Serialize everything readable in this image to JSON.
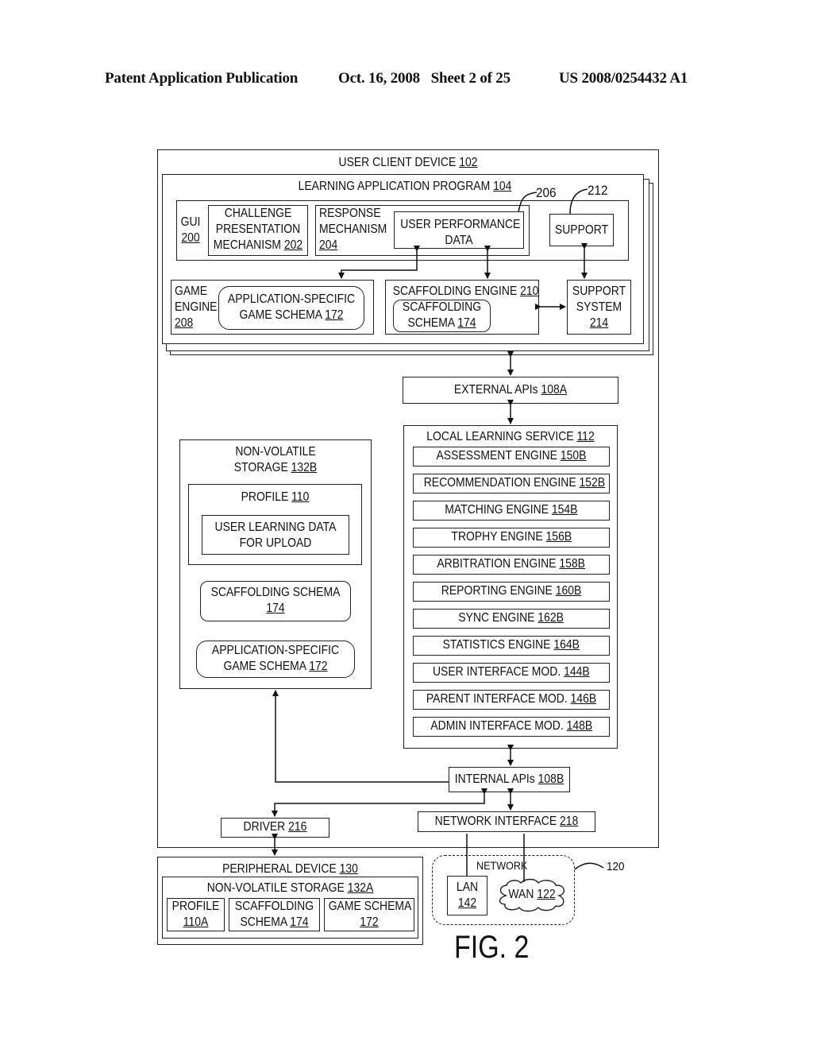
{
  "header": {
    "publication": "Patent Application Publication",
    "date_sheet": "Oct. 16, 2008   Sheet 2 of 25",
    "patent_number": "US 2008/0254432 A1"
  },
  "figure_label": "FIG. 2",
  "user_client_device": {
    "label": "USER CLIENT DEVICE",
    "ref": "102"
  },
  "learning_app": {
    "label": "LEARNING APPLICATION PROGRAM",
    "ref": "104"
  },
  "callouts": {
    "user_perf": "206",
    "support": "212",
    "network": "120"
  },
  "gui": {
    "label": "GUI",
    "ref": "200"
  },
  "challenge": {
    "line1": "CHALLENGE",
    "line2": "PRESENTATION",
    "line3": "MECHANISM",
    "ref": "202"
  },
  "response": {
    "line1": "RESPONSE",
    "line2": "MECHANISM",
    "ref": "204"
  },
  "user_performance": {
    "line1": "USER PERFORMANCE",
    "line2": "DATA"
  },
  "support": {
    "label": "SUPPORT"
  },
  "game_engine": {
    "line1": "GAME",
    "line2": "ENGINE",
    "ref": "208"
  },
  "app_game_schema": {
    "line1": "APPLICATION-SPECIFIC",
    "line2": "GAME SCHEMA",
    "ref": "172"
  },
  "scaffolding_engine": {
    "label": "SCAFFOLDING ENGINE",
    "ref": "210"
  },
  "scaffolding_schema_inner": {
    "line1": "SCAFFOLDING",
    "line2": "SCHEMA",
    "ref": "174"
  },
  "support_system": {
    "line1": "SUPPORT",
    "line2": "SYSTEM",
    "ref": "214"
  },
  "external_apis": {
    "label": "EXTERNAL APIs",
    "ref": "108A"
  },
  "local_learning_service": {
    "label": "LOCAL LEARNING SERVICE",
    "ref": "112",
    "modules": [
      {
        "label": "ASSESSMENT ENGINE",
        "ref": "150B"
      },
      {
        "label": "RECOMMENDATION ENGINE",
        "ref": "152B"
      },
      {
        "label": "MATCHING ENGINE",
        "ref": "154B"
      },
      {
        "label": "TROPHY ENGINE",
        "ref": "156B"
      },
      {
        "label": "ARBITRATION ENGINE",
        "ref": "158B"
      },
      {
        "label": "REPORTING ENGINE",
        "ref": "160B"
      },
      {
        "label": "SYNC ENGINE",
        "ref": "162B"
      },
      {
        "label": "STATISTICS ENGINE",
        "ref": "164B"
      },
      {
        "label": "USER INTERFACE MOD.",
        "ref": "144B"
      },
      {
        "label": "PARENT INTERFACE MOD.",
        "ref": "146B"
      },
      {
        "label": "ADMIN INTERFACE MOD.",
        "ref": "148B"
      }
    ]
  },
  "nv_storage_b": {
    "line1": "NON-VOLATILE",
    "line2": "STORAGE",
    "ref": "132B"
  },
  "profile_110": {
    "label": "PROFILE",
    "ref": "110"
  },
  "user_learning_data": {
    "line1": "USER LEARNING DATA",
    "line2": "FOR UPLOAD"
  },
  "scaffolding_schema_b": {
    "line1": "SCAFFOLDING SCHEMA",
    "ref": "174"
  },
  "app_game_schema_b": {
    "line1": "APPLICATION-SPECIFIC",
    "line2": "GAME SCHEMA",
    "ref": "172"
  },
  "internal_apis": {
    "label": "INTERNAL APIs",
    "ref": "108B"
  },
  "driver": {
    "label": "DRIVER",
    "ref": "216"
  },
  "network_interface": {
    "label": "NETWORK INTERFACE",
    "ref": "218"
  },
  "peripheral": {
    "label": "PERIPHERAL DEVICE",
    "ref": "130"
  },
  "nv_storage_a": {
    "label": "NON-VOLATILE STORAGE",
    "ref": "132A"
  },
  "profile_a": {
    "line1": "PROFILE",
    "ref": "110A"
  },
  "scaffolding_a": {
    "line1": "SCAFFOLDING",
    "line2": "SCHEMA",
    "ref": "174"
  },
  "game_schema_a": {
    "line1": "GAME SCHEMA",
    "ref": "172"
  },
  "network": {
    "label": "NETWORK"
  },
  "lan": {
    "label": "LAN",
    "ref": "142"
  },
  "wan": {
    "label": "WAN",
    "ref": "122"
  }
}
